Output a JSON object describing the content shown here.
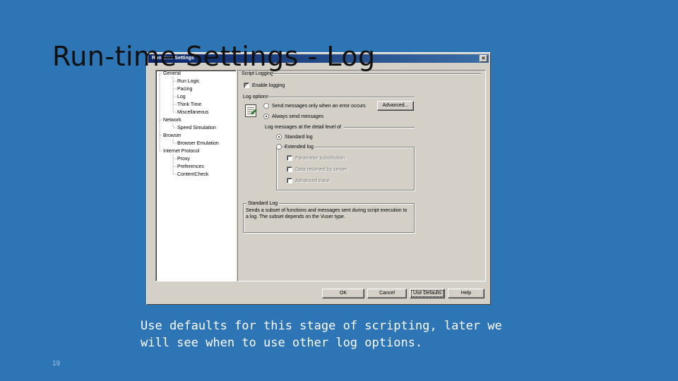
{
  "slide": {
    "title": "Run-time Settings - Log",
    "caption": "Use defaults for this stage of scripting, later we will see when to use other log options.",
    "slide_number": "19"
  },
  "dialog": {
    "title": "Run-time Settings",
    "close_glyph": "×",
    "tree": [
      {
        "label": "General",
        "level": 0
      },
      {
        "label": "Run Logic",
        "level": 1
      },
      {
        "label": "Pacing",
        "level": 1
      },
      {
        "label": "Log",
        "level": 1
      },
      {
        "label": "Think Time",
        "level": 1
      },
      {
        "label": "Miscellaneous",
        "level": 1
      },
      {
        "label": "Network",
        "level": 0
      },
      {
        "label": "Speed Simulation",
        "level": 1
      },
      {
        "label": "Browser",
        "level": 0
      },
      {
        "label": "Browser Emulation",
        "level": 1
      },
      {
        "label": "Internet Protocol",
        "level": 0
      },
      {
        "label": "Proxy",
        "level": 1
      },
      {
        "label": "Preferences",
        "level": 1
      },
      {
        "label": "ContentCheck",
        "level": 1
      }
    ],
    "section_header": "Script Logging",
    "enable_logging_label": "Enable logging",
    "log_options_label": "Log options",
    "send_on_error_label": "Send messages only when an error occurs",
    "advanced_button": "Advanced...",
    "always_send_label": "Always send messages",
    "detail_level_label": "Log messages at the detail level of",
    "standard_log_label": "Standard log",
    "extended_log_label": "Extended log",
    "extended_options": [
      "Parameter substitution",
      "Data returned by server",
      "Advanced trace"
    ],
    "description_group_label": "Standard Log",
    "description_text": "Sends a subset of functions and messages sent during script execution to a log. The subset depends on the Vuser type.",
    "buttons": {
      "ok": "OK",
      "cancel": "Cancel",
      "use_defaults": "Use Defaults",
      "help": "Help"
    }
  }
}
